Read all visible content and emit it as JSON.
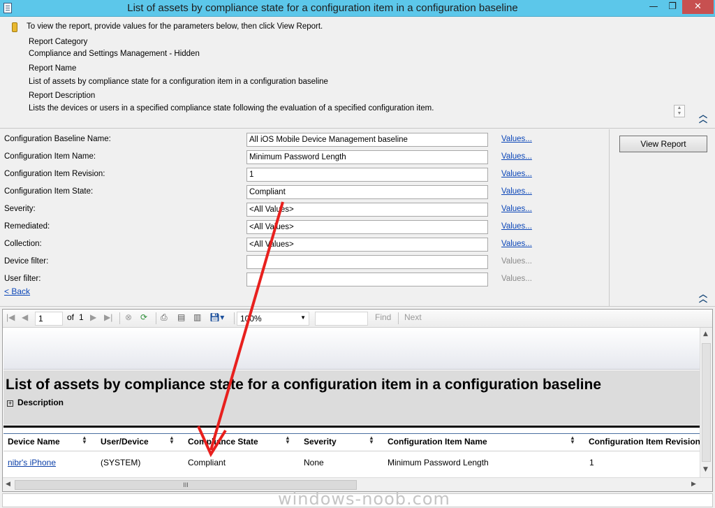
{
  "window": {
    "title": "List of assets by compliance state for a configuration item in a configuration baseline",
    "minimize": "—",
    "maximize": "❐",
    "close": "✕"
  },
  "info": {
    "instruction": "To view the report, provide values for the parameters below, then click View Report.",
    "category_label": "Report Category",
    "category_value": "Compliance and Settings Management - Hidden",
    "name_label": "Report Name",
    "name_value": "List of assets by compliance state for a configuration item in a configuration baseline",
    "description_label": "Report Description",
    "description_value": "Lists the devices or users in a specified compliance state following the evaluation of a specified configuration item."
  },
  "params": [
    {
      "label": "Configuration Baseline Name:",
      "value": "All iOS Mobile Device Management baseline",
      "link": "Values...",
      "link_enabled": true
    },
    {
      "label": "Configuration Item Name:",
      "value": "Minimum Password Length",
      "link": "Values...",
      "link_enabled": true
    },
    {
      "label": "Configuration Item Revision:",
      "value": "1",
      "link": "Values...",
      "link_enabled": true
    },
    {
      "label": "Configuration Item State:",
      "value": "Compliant",
      "link": "Values...",
      "link_enabled": true
    },
    {
      "label": "Severity:",
      "value": "<All Values>",
      "link": "Values...",
      "link_enabled": true
    },
    {
      "label": "Remediated:",
      "value": "<All Values>",
      "link": "Values...",
      "link_enabled": true
    },
    {
      "label": "Collection:",
      "value": "<All Values>",
      "link": "Values...",
      "link_enabled": true
    },
    {
      "label": "Device filter:",
      "value": "",
      "link": "Values...",
      "link_enabled": false
    },
    {
      "label": "User filter:",
      "value": "",
      "link": "Values...",
      "link_enabled": false
    }
  ],
  "back_link": "< Back",
  "view_report_button": "View Report",
  "toolbar": {
    "page_current": "1",
    "page_of": "of",
    "page_total": "1",
    "zoom": "100%",
    "find_placeholder": "",
    "find_label": "Find",
    "next_label": "Next"
  },
  "report": {
    "title": "List of assets by compliance state for a configuration item in a configuration baseline",
    "description_toggle": "Description",
    "columns": [
      "Device Name",
      "User/Device",
      "Compliance State",
      "Severity",
      "Configuration Item Name",
      "Configuration Item Revision"
    ],
    "rows": [
      [
        "nibr's iPhone",
        "(SYSTEM)",
        "Compliant",
        "None",
        "Minimum Password Length",
        "1"
      ]
    ]
  },
  "watermark": "windows-noob.com",
  "colors": {
    "titlebar": "#5cc7ea",
    "close_button": "#c75050",
    "link": "#0b46b8",
    "annotation_arrow": "#e8201e"
  }
}
